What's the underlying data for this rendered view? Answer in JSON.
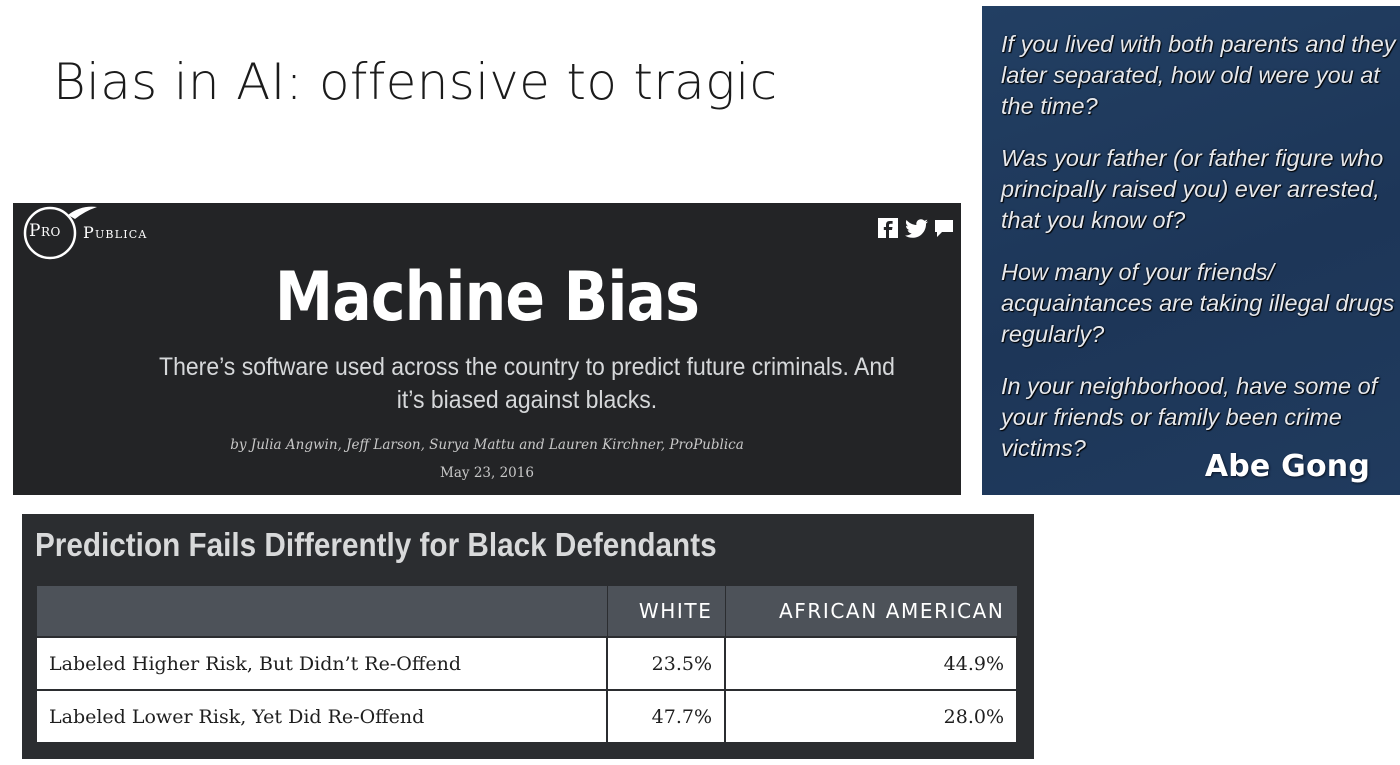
{
  "slide": {
    "title": "Bias in AI: offensive to tragic"
  },
  "propublica": {
    "logo_pro": "Pro",
    "logo_publica": "Publica",
    "headline": "Machine Bias",
    "dek": "There’s software used across the country to predict future criminals. And it’s biased against blacks.",
    "byline": "by Julia Angwin, Jeff Larson, Surya Mattu and Lauren Kirchner, ProPublica",
    "date": "May 23, 2016",
    "social_icons": [
      "facebook-icon",
      "twitter-icon",
      "comment-icon"
    ]
  },
  "questions": {
    "items": [
      "If you lived with both parents and they later separated, how old were you at the time?",
      "Was your father (or father figure who principally raised you) ever arrested, that you know of?",
      "How many of your friends/ acquaintances are taking illegal drugs regularly?",
      "In your neighborhood, have some of your friends or family been crime victims?"
    ],
    "credit": "Abe Gong"
  },
  "table": {
    "title": "Prediction Fails Differently for Black Defendants",
    "headers": [
      "",
      "WHITE",
      "AFRICAN AMERICAN"
    ],
    "rows": [
      {
        "label": "Labeled Higher Risk, But Didn’t Re-Offend",
        "white": "23.5%",
        "african_american": "44.9%"
      },
      {
        "label": "Labeled Lower Risk, Yet Did Re-Offend",
        "white": "47.7%",
        "african_american": "28.0%"
      }
    ]
  },
  "colors": {
    "propublica_bg": "#232426",
    "questions_bg": "#1f3a5c",
    "table_panel_bg": "#2b2d30",
    "table_header_bg": "#4d5259"
  }
}
